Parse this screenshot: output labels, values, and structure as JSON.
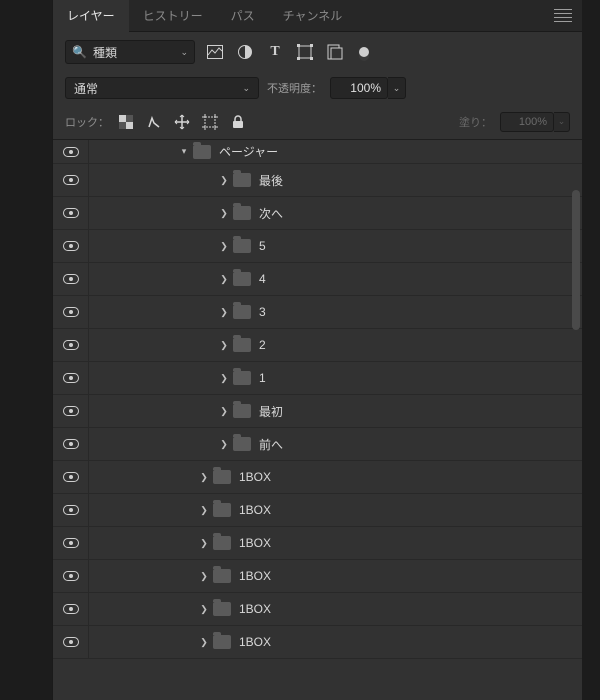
{
  "tabs": {
    "layers": "レイヤー",
    "history": "ヒストリー",
    "paths": "パス",
    "channels": "チャンネル"
  },
  "filter": {
    "kind_label": "種類"
  },
  "blend": {
    "mode_label": "通常",
    "opacity_label": "不透明度：",
    "opacity_value": "100%"
  },
  "lock_row": {
    "lock_label": "ロック：",
    "fill_label": "塗り：",
    "fill_value": "100%"
  },
  "layers": [
    {
      "indent": 90,
      "twisty": "down",
      "label": "ページャー",
      "partial": true
    },
    {
      "indent": 130,
      "twisty": "right",
      "label": "最後"
    },
    {
      "indent": 130,
      "twisty": "right",
      "label": "次へ"
    },
    {
      "indent": 130,
      "twisty": "right",
      "label": "5"
    },
    {
      "indent": 130,
      "twisty": "right",
      "label": "4"
    },
    {
      "indent": 130,
      "twisty": "right",
      "label": "3"
    },
    {
      "indent": 130,
      "twisty": "right",
      "label": "2"
    },
    {
      "indent": 130,
      "twisty": "right",
      "label": "1"
    },
    {
      "indent": 130,
      "twisty": "right",
      "label": "最初"
    },
    {
      "indent": 130,
      "twisty": "right",
      "label": "前へ"
    },
    {
      "indent": 110,
      "twisty": "right",
      "label": "1BOX"
    },
    {
      "indent": 110,
      "twisty": "right",
      "label": "1BOX"
    },
    {
      "indent": 110,
      "twisty": "right",
      "label": "1BOX"
    },
    {
      "indent": 110,
      "twisty": "right",
      "label": "1BOX"
    },
    {
      "indent": 110,
      "twisty": "right",
      "label": "1BOX"
    },
    {
      "indent": 110,
      "twisty": "right",
      "label": "1BOX"
    }
  ]
}
